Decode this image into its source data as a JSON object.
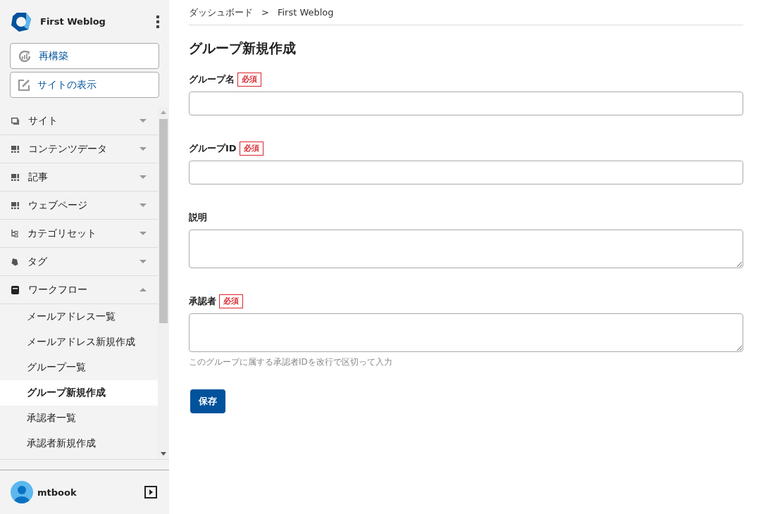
{
  "sidebar": {
    "site_name": "First Weblog",
    "actions": [
      {
        "label": "再構築"
      },
      {
        "label": "サイトの表示"
      }
    ],
    "nav": [
      {
        "label": "サイト",
        "expanded": false
      },
      {
        "label": "コンテンツデータ",
        "expanded": false
      },
      {
        "label": "記事",
        "expanded": false
      },
      {
        "label": "ウェブページ",
        "expanded": false
      },
      {
        "label": "カテゴリセット",
        "expanded": false
      },
      {
        "label": "タグ",
        "expanded": false
      },
      {
        "label": "ワークフロー",
        "expanded": true,
        "children": [
          {
            "label": "メールアドレス一覧",
            "selected": false
          },
          {
            "label": "メールアドレス新規作成",
            "selected": false
          },
          {
            "label": "グループ一覧",
            "selected": false
          },
          {
            "label": "グループ新規作成",
            "selected": true
          },
          {
            "label": "承認者一覧",
            "selected": false
          },
          {
            "label": "承認者新規作成",
            "selected": false
          }
        ]
      }
    ],
    "user": {
      "name": "mtbook"
    }
  },
  "breadcrumb": [
    "ダッシュボード",
    "First Weblog"
  ],
  "breadcrumb_separator": ">",
  "page_title": "グループ新規作成",
  "fields": [
    {
      "kind": "text",
      "label": "グループ名",
      "required": true,
      "required_badge": "必須"
    },
    {
      "kind": "text",
      "label": "グループID",
      "required": true,
      "required_badge": "必須"
    },
    {
      "kind": "textarea",
      "label": "説明",
      "required": false
    },
    {
      "kind": "textarea",
      "label": "承認者",
      "required": true,
      "required_badge": "必須",
      "hint": "このグループに属する承認者IDを改行で区切って入力"
    }
  ],
  "save_button": "保存"
}
